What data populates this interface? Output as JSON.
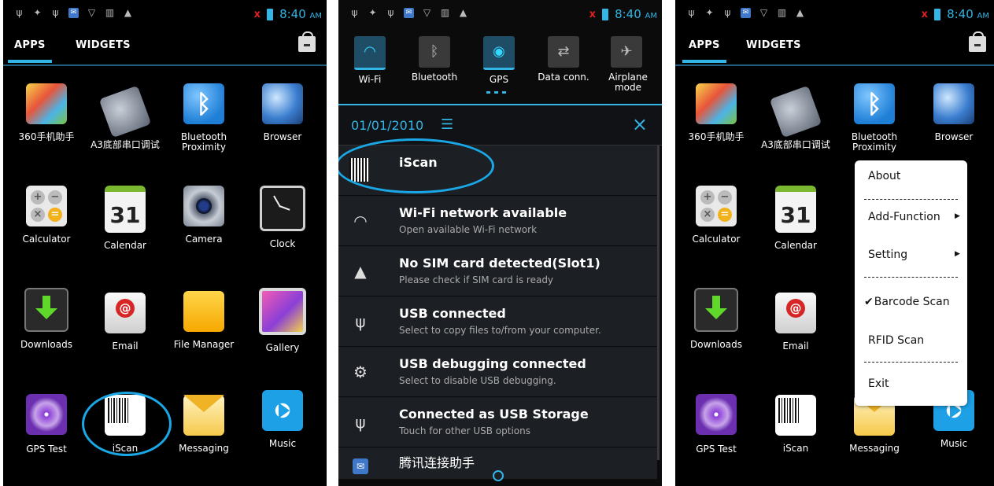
{
  "status_bar": {
    "time": "8:40",
    "ampm": "AM"
  },
  "drawer": {
    "tabs": [
      "APPS",
      "WIDGETS"
    ],
    "apps": [
      {
        "label": "360手机助手",
        "icon": "360-assistant-icon"
      },
      {
        "label": "A3底部串口调试",
        "icon": "serial-port-icon"
      },
      {
        "label": "Bluetooth Proximity",
        "icon": "bluetooth-icon"
      },
      {
        "label": "Browser",
        "icon": "browser-globe-icon"
      },
      {
        "label": "Calculator",
        "icon": "calculator-icon"
      },
      {
        "label": "Calendar",
        "icon": "calendar-icon"
      },
      {
        "label": "Camera",
        "icon": "camera-icon"
      },
      {
        "label": "Clock",
        "icon": "clock-icon"
      },
      {
        "label": "Downloads",
        "icon": "downloads-icon"
      },
      {
        "label": "Email",
        "icon": "email-icon"
      },
      {
        "label": "File Manager",
        "icon": "folder-icon"
      },
      {
        "label": "Gallery",
        "icon": "gallery-icon"
      },
      {
        "label": "GPS Test",
        "icon": "gps-test-icon"
      },
      {
        "label": "iScan",
        "icon": "barcode-icon"
      },
      {
        "label": "Messaging",
        "icon": "messaging-icon"
      },
      {
        "label": "Music",
        "icon": "music-icon"
      }
    ],
    "calendar_day": "31"
  },
  "quick_settings": [
    {
      "label": "Wi-Fi",
      "icon": "wifi-icon",
      "on": true
    },
    {
      "label": "Bluetooth",
      "icon": "bluetooth-icon",
      "on": false
    },
    {
      "label": "GPS",
      "icon": "gps-icon",
      "on": true
    },
    {
      "label": "Data conn.",
      "icon": "data-connection-icon",
      "on": false
    },
    {
      "label": "Airplane mode",
      "icon": "airplane-icon",
      "on": false
    }
  ],
  "notification_panel": {
    "date": "01/01/2010",
    "notifications": [
      {
        "title": "iScan",
        "subtitle": "",
        "icon": "barcode-icon"
      },
      {
        "title": "Wi-Fi network available",
        "subtitle": "Open available Wi-Fi network",
        "icon": "wifi-icon"
      },
      {
        "title": "No SIM card detected(Slot1)",
        "subtitle": "Please check if SIM card is ready",
        "icon": "warning-icon"
      },
      {
        "title": "USB connected",
        "subtitle": "Select to copy files to/from your computer.",
        "icon": "usb-icon"
      },
      {
        "title": "USB debugging connected",
        "subtitle": "Select to disable USB debugging.",
        "icon": "android-debug-icon"
      },
      {
        "title": "Connected as USB Storage",
        "subtitle": "Touch for other USB options",
        "icon": "usb-icon"
      },
      {
        "title": "腾讯连接助手",
        "subtitle": "",
        "icon": "tencent-icon"
      }
    ]
  },
  "menu": {
    "about": "About",
    "add_function": "Add-Function",
    "setting": "Setting",
    "barcode_scan": "Barcode Scan",
    "rfid_scan": "RFID Scan",
    "exit": "Exit",
    "checked_item": "Barcode Scan"
  },
  "colors": {
    "accent": "#33b5e5",
    "highlight_ring": "#1aa7e6",
    "warning_x": "#e02020"
  }
}
